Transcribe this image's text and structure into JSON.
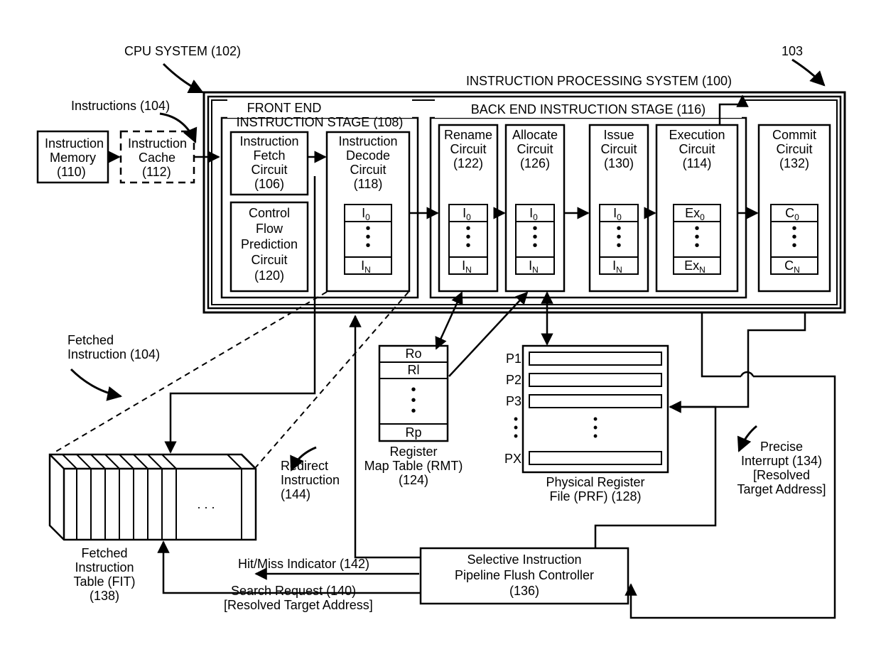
{
  "title": {
    "cpu": "CPU SYSTEM (102)",
    "ref103": "103",
    "ips": "INSTRUCTION PROCESSING SYSTEM (100)"
  },
  "imem": {
    "l1": "Instruction",
    "l2": "Memory",
    "l3": "(110)"
  },
  "icache": {
    "l1": "Instruction",
    "l2": "Cache",
    "l3": "(112)"
  },
  "instr": {
    "label": "Instructions (104)"
  },
  "frontend": {
    "l1": "FRONT END",
    "l2": "INSTRUCTION STAGE (108)"
  },
  "ifetch": {
    "l1": "Instruction",
    "l2": "Fetch",
    "l3": "Circuit",
    "l4": "(106)"
  },
  "cfp": {
    "l1": "Control",
    "l2": "Flow",
    "l3": "Prediction",
    "l4": "Circuit",
    "l5": "(120)"
  },
  "idec": {
    "l1": "Instruction",
    "l2": "Decode",
    "l3": "Circuit",
    "l4": "(118)",
    "slot0": "I",
    "slotN": "I",
    "sub0": "0",
    "subN": "N"
  },
  "backend": {
    "l1": "BACK END INSTRUCTION STAGE (116)"
  },
  "rename": {
    "l1": "Rename",
    "l2": "Circuit",
    "l3": "(122)",
    "slot0": "I",
    "slotN": "I",
    "sub0": "0",
    "subN": "N"
  },
  "alloc": {
    "l1": "Allocate",
    "l2": "Circuit",
    "l3": "(126)",
    "slot0": "I",
    "slotN": "I",
    "sub0": "0",
    "subN": "N"
  },
  "issue": {
    "l1": "Issue",
    "l2": "Circuit",
    "l3": "(130)",
    "slot0": "I",
    "slotN": "I",
    "sub0": "0",
    "subN": "N"
  },
  "exec": {
    "l1": "Execution",
    "l2": "Circuit",
    "l3": "(114)",
    "slot0": "Ex",
    "slotN": "Ex",
    "sub0": "0",
    "subN": "N"
  },
  "commit": {
    "l1": "Commit",
    "l2": "Circuit",
    "l3": "(132)",
    "slot0": "C",
    "slotN": "C",
    "sub0": "0",
    "subN": "N"
  },
  "rmt": {
    "r0": "Ro",
    "r1": "Rl",
    "rp": "Rp",
    "l1": "Register",
    "l2": "Map Table (RMT)",
    "l3": "(124)"
  },
  "prf": {
    "p1": "P1",
    "p2": "P2",
    "p3": "P3",
    "px": "PX",
    "l1": "Physical Register",
    "l2": "File (PRF) (128)"
  },
  "fit": {
    "l1": "Fetched",
    "l2": "Instruction",
    "l3": "Table (FIT)",
    "l4": "(138)",
    "dots": ". . ."
  },
  "fetched": {
    "l1": "Fetched",
    "l2": "Instruction (104)"
  },
  "redirect": {
    "l1": "Redirect",
    "l2": "Instruction",
    "l3": "(144)"
  },
  "hitmiss": {
    "l1": "Hit/Miss Indicator (142)"
  },
  "search": {
    "l1": "Search Request (140)",
    "l2": "[Resolved Target Address]"
  },
  "sipfc": {
    "l1": "Selective Instruction",
    "l2": "Pipeline Flush Controller",
    "l3": "(136)"
  },
  "precise": {
    "l1": "Precise",
    "l2": "Interrupt (134)",
    "l3": "[Resolved",
    "l4": "Target Address]"
  },
  "dots": ":"
}
